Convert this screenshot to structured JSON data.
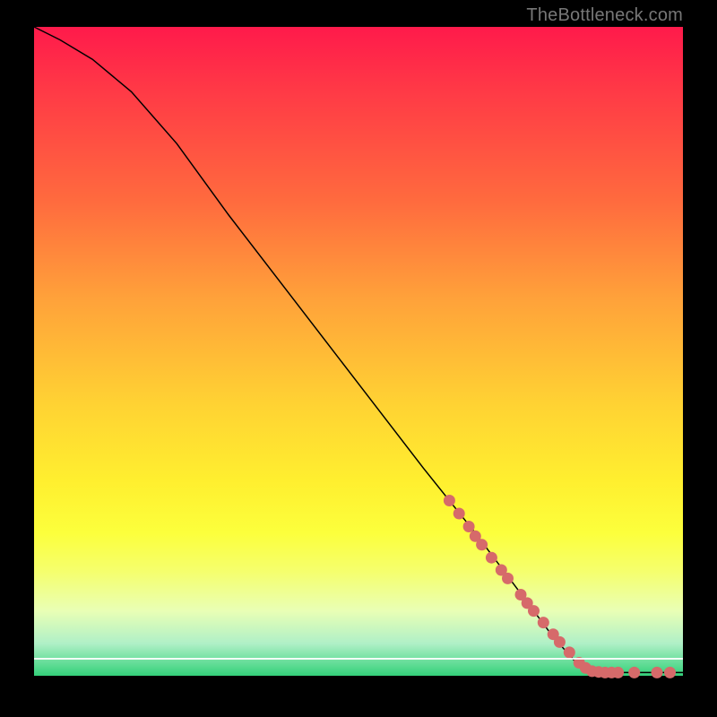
{
  "watermark": "TheBottleneck.com",
  "chart_data": {
    "type": "line",
    "title": "",
    "xlabel": "",
    "ylabel": "",
    "xlim": [
      0,
      100
    ],
    "ylim": [
      0,
      100
    ],
    "curve": [
      {
        "x": 0,
        "y": 100
      },
      {
        "x": 4,
        "y": 98
      },
      {
        "x": 9,
        "y": 95
      },
      {
        "x": 15,
        "y": 90
      },
      {
        "x": 22,
        "y": 82
      },
      {
        "x": 30,
        "y": 71
      },
      {
        "x": 40,
        "y": 58
      },
      {
        "x": 50,
        "y": 45
      },
      {
        "x": 60,
        "y": 32
      },
      {
        "x": 68,
        "y": 22
      },
      {
        "x": 74,
        "y": 14
      },
      {
        "x": 80,
        "y": 6
      },
      {
        "x": 84,
        "y": 1.5
      },
      {
        "x": 86,
        "y": 0.7
      },
      {
        "x": 90,
        "y": 0.5
      },
      {
        "x": 100,
        "y": 0.5
      }
    ],
    "markers": [
      {
        "x": 64,
        "y": 27.0
      },
      {
        "x": 65.5,
        "y": 25.0
      },
      {
        "x": 67,
        "y": 23.0
      },
      {
        "x": 68,
        "y": 21.5
      },
      {
        "x": 69,
        "y": 20.2
      },
      {
        "x": 70.5,
        "y": 18.2
      },
      {
        "x": 72,
        "y": 16.3
      },
      {
        "x": 73,
        "y": 15.0
      },
      {
        "x": 75,
        "y": 12.5
      },
      {
        "x": 76,
        "y": 11.2
      },
      {
        "x": 77,
        "y": 10.0
      },
      {
        "x": 78.5,
        "y": 8.2
      },
      {
        "x": 80,
        "y": 6.4
      },
      {
        "x": 81,
        "y": 5.2
      },
      {
        "x": 82.5,
        "y": 3.6
      },
      {
        "x": 84,
        "y": 2.0
      },
      {
        "x": 85,
        "y": 1.2
      },
      {
        "x": 86,
        "y": 0.7
      },
      {
        "x": 87,
        "y": 0.6
      },
      {
        "x": 88,
        "y": 0.5
      },
      {
        "x": 89,
        "y": 0.5
      },
      {
        "x": 90,
        "y": 0.5
      },
      {
        "x": 92.5,
        "y": 0.5
      },
      {
        "x": 96,
        "y": 0.5
      },
      {
        "x": 98,
        "y": 0.5
      }
    ]
  }
}
